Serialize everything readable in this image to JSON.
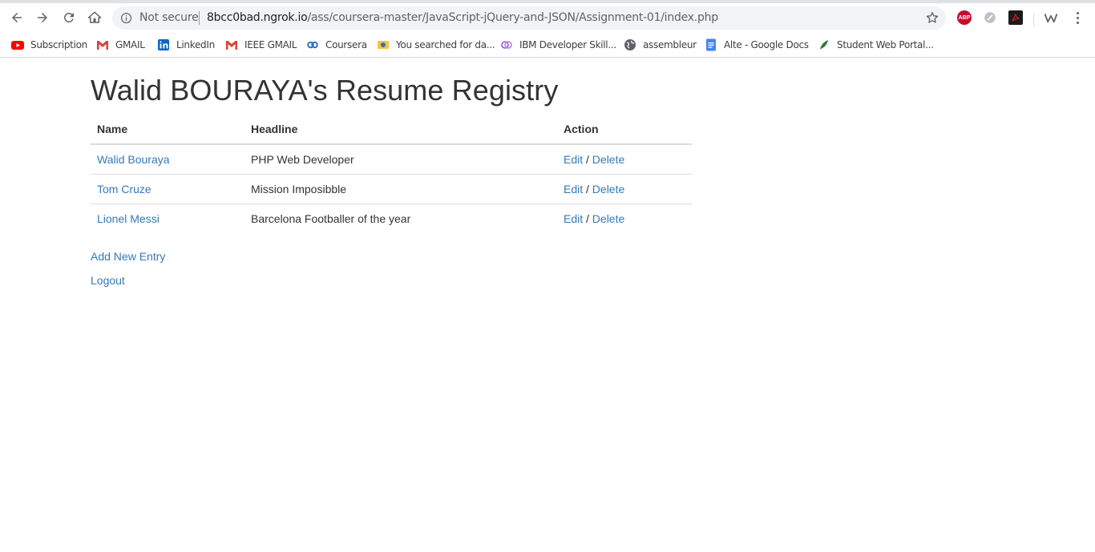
{
  "browser": {
    "security_label": "Not secure",
    "url_host": "8bcc0bad.ngrok.io",
    "url_path": "/ass/coursera-master/JavaScript-jQuery-and-JSON/Assignment-01/index.php",
    "abp_label": "ABP"
  },
  "bookmarks": [
    {
      "label": "Subscription",
      "icon": "youtube-icon"
    },
    {
      "label": "GMAIL",
      "icon": "gmail-icon"
    },
    {
      "label": "LinkedIn",
      "icon": "linkedin-icon"
    },
    {
      "label": "IEEE GMAIL",
      "icon": "gmail-icon"
    },
    {
      "label": "Coursera",
      "icon": "coursera-icon"
    },
    {
      "label": "You searched for da...",
      "icon": "search-site-icon"
    },
    {
      "label": "IBM Developer Skill...",
      "icon": "ibm-icon"
    },
    {
      "label": "assembleur",
      "icon": "globe-icon"
    },
    {
      "label": "Alte - Google Docs",
      "icon": "google-docs-icon"
    },
    {
      "label": "Student Web Portal...",
      "icon": "leaf-icon"
    }
  ],
  "page": {
    "title": "Walid BOURAYA's Resume Registry",
    "table": {
      "headers": [
        "Name",
        "Headline",
        "Action"
      ],
      "rows": [
        {
          "name": "Walid Bouraya",
          "headline": "PHP Web Developer",
          "edit": "Edit",
          "sep": " / ",
          "delete": "Delete"
        },
        {
          "name": "Tom Cruze",
          "headline": "Mission Imposibble",
          "edit": "Edit",
          "sep": " / ",
          "delete": "Delete"
        },
        {
          "name": "Lionel Messi",
          "headline": "Barcelona Footballer of the year",
          "edit": "Edit",
          "sep": " / ",
          "delete": "Delete"
        }
      ]
    },
    "add_link": "Add New Entry",
    "logout_link": "Logout"
  },
  "colors": {
    "link": "#337ab7",
    "text": "#333333",
    "table_border": "#dddddd"
  }
}
